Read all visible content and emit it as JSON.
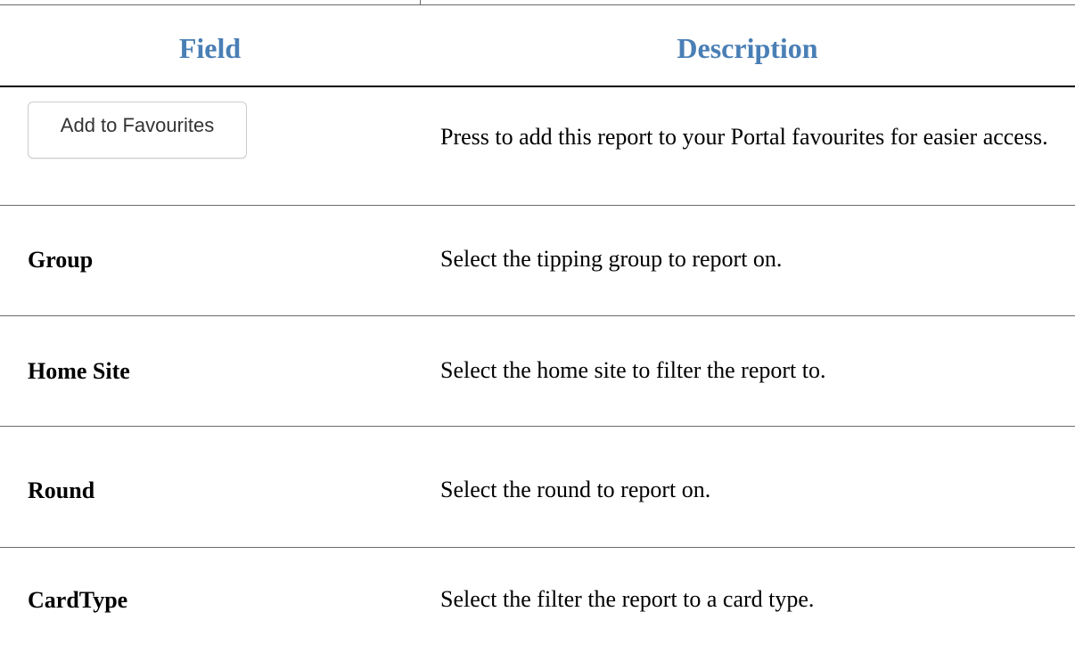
{
  "table": {
    "header": {
      "field": "Field",
      "description": "Description"
    },
    "add_favourites": {
      "button_label": "Add to Favourites",
      "description": "Press to add this report to your Portal favourites for easier access."
    },
    "rows": [
      {
        "field": "Group",
        "description": "Select the tipping group to report on."
      },
      {
        "field": "Home Site",
        "description": "Select the home site to filter the report to."
      },
      {
        "field": "Round",
        "description": "Select the round to report on."
      },
      {
        "field": "CardType",
        "description": "Select the filter the report to a card type."
      }
    ]
  },
  "colors": {
    "header_text": "#4a7fb5",
    "rule": "#6b6b6b",
    "header_rule": "#000000"
  }
}
